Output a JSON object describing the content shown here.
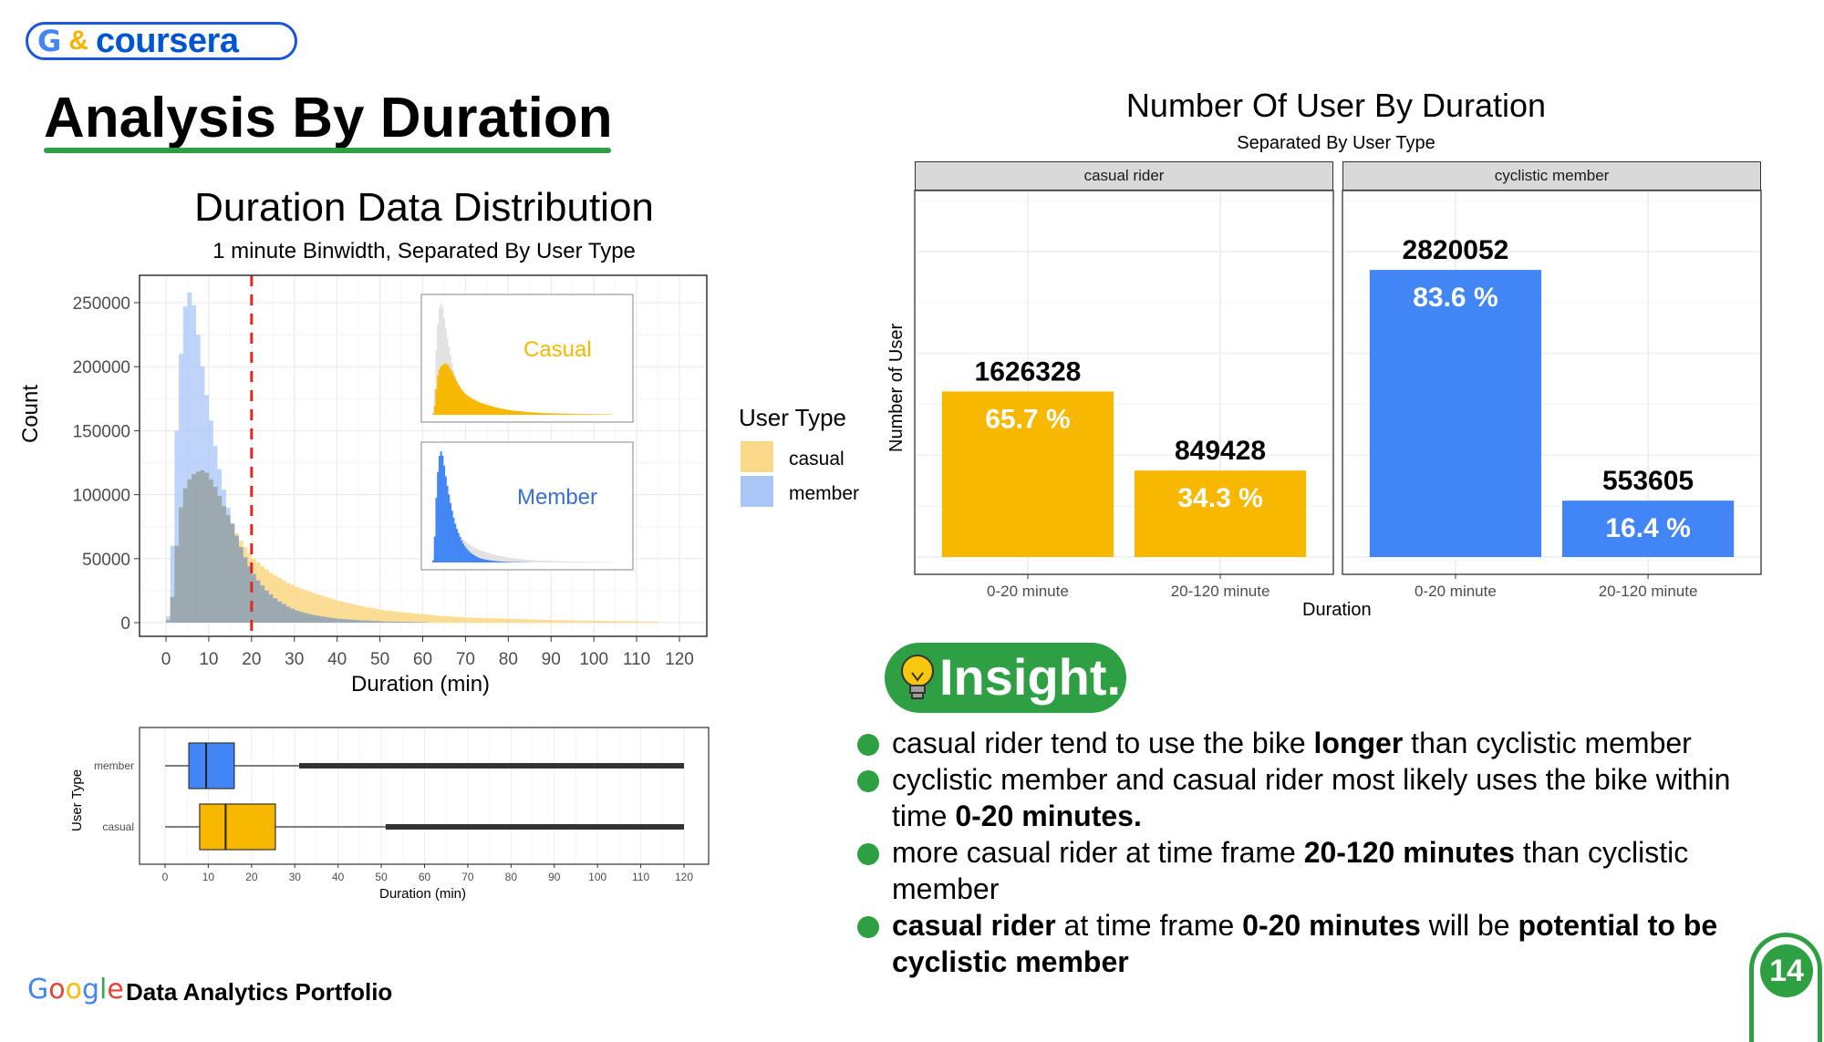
{
  "brand": {
    "g": "G",
    "amp": "&",
    "name": "coursera"
  },
  "page_title": "Analysis By Duration",
  "colors": {
    "casual": "#f9b800",
    "member": "#4285f4",
    "casual_fill_light": "#fbd98a",
    "member_fill_light": "#a9c6f7",
    "green": "#2ea043",
    "cutoff": "#e0281f"
  },
  "histogram": {
    "title": "Duration Data Distribution",
    "subtitle": "1 minute Binwidth, Separated By User Type",
    "inset_labels": {
      "casual": "Casual",
      "member": "Member"
    }
  },
  "legend": {
    "title": "User Type",
    "items": [
      "casual",
      "member"
    ]
  },
  "boxplot": {},
  "bar_chart": {
    "title": "Number Of User By Duration",
    "subtitle": "Separated By User Type"
  },
  "chart_data": [
    {
      "type": "bar",
      "subtype": "histogram",
      "title": "Duration Data Distribution",
      "subtitle": "1 minute Binwidth, Separated By User Type",
      "xlabel": "Duration (min)",
      "ylabel": "Count",
      "xlim": [
        0,
        120
      ],
      "ylim": [
        0,
        260000
      ],
      "x_ticks": [
        0,
        10,
        20,
        30,
        40,
        50,
        60,
        70,
        80,
        90,
        100,
        110,
        120
      ],
      "y_ticks": [
        0,
        50000,
        100000,
        150000,
        200000,
        250000
      ],
      "y_tick_labels": [
        "0",
        "50000",
        "100000",
        "150000",
        "200000",
        "250000"
      ],
      "reference_line": {
        "x": 20,
        "style": "dashed"
      },
      "grid": true,
      "series": [
        {
          "name": "member",
          "color": "#a9c6f7",
          "x": [
            0,
            1,
            2,
            3,
            4,
            5,
            6,
            7,
            8,
            9,
            10,
            11,
            12,
            13,
            14,
            15,
            16,
            17,
            18,
            19,
            20,
            21,
            22,
            23,
            24,
            25,
            26,
            27,
            28,
            29,
            30,
            32,
            34,
            36,
            38,
            40,
            45,
            50,
            55,
            60
          ],
          "values": [
            5000,
            60000,
            150000,
            210000,
            247000,
            258000,
            248000,
            225000,
            200000,
            178000,
            158000,
            138000,
            120000,
            104000,
            90000,
            78000,
            68000,
            59000,
            51000,
            44000,
            38000,
            33000,
            29000,
            25000,
            22000,
            19000,
            16500,
            14500,
            12500,
            11000,
            9500,
            7500,
            6000,
            4800,
            3800,
            3000,
            1800,
            1000,
            600,
            300
          ]
        },
        {
          "name": "casual",
          "color": "#fbd98a",
          "x": [
            0,
            1,
            2,
            3,
            4,
            5,
            6,
            7,
            8,
            9,
            10,
            11,
            12,
            13,
            14,
            15,
            16,
            17,
            18,
            19,
            20,
            22,
            24,
            26,
            28,
            30,
            35,
            40,
            45,
            50,
            55,
            60,
            65,
            70,
            80,
            90,
            100,
            110,
            114
          ],
          "values": [
            2000,
            20000,
            60000,
            90000,
            105000,
            112000,
            116000,
            118000,
            119000,
            117000,
            112000,
            106000,
            99000,
            91000,
            84000,
            77000,
            70000,
            64000,
            59000,
            54000,
            50000,
            44000,
            39000,
            35000,
            31000,
            28000,
            22000,
            17000,
            13000,
            10000,
            8000,
            6500,
            5000,
            4000,
            3000,
            2000,
            1500,
            1000,
            800
          ]
        }
      ],
      "insets": [
        {
          "label": "Casual",
          "series": "casual"
        },
        {
          "label": "Member",
          "series": "member"
        }
      ]
    },
    {
      "type": "boxplot",
      "xlabel": "Duration (min)",
      "ylabel": "User Type",
      "xlim": [
        0,
        120
      ],
      "x_ticks": [
        0,
        10,
        20,
        30,
        40,
        50,
        60,
        70,
        80,
        90,
        100,
        110,
        120
      ],
      "categories": [
        "member",
        "casual"
      ],
      "series": [
        {
          "name": "member",
          "color": "#4285f4",
          "whisker_low": 0,
          "q1": 5.5,
          "median": 9.5,
          "q3": 16,
          "whisker_high": 31,
          "outliers_to": 120
        },
        {
          "name": "casual",
          "color": "#f9b800",
          "whisker_low": 0,
          "q1": 8,
          "median": 14,
          "q3": 25.5,
          "whisker_high": 51,
          "outliers_to": 120
        }
      ]
    },
    {
      "type": "bar",
      "title": "Number Of User By Duration",
      "subtitle": "Separated By User Type",
      "xlabel": "Duration",
      "ylabel": "Number of User",
      "categories": [
        "0-20 minute",
        "20-120 minute"
      ],
      "ylim": [
        0,
        3600000
      ],
      "facets": [
        {
          "name": "casual rider",
          "color": "#f9b800",
          "values": [
            1626328,
            849428
          ],
          "value_labels": [
            "1626328",
            "849428"
          ],
          "percent_labels": [
            "65.7 %",
            "34.3 %"
          ]
        },
        {
          "name": "cyclistic member",
          "color": "#4285f4",
          "values": [
            2820052,
            553605
          ],
          "value_labels": [
            "2820052",
            "553605"
          ],
          "percent_labels": [
            "83.6 %",
            "16.4 %"
          ]
        }
      ]
    }
  ],
  "insight": {
    "label": "Insight.",
    "items": [
      [
        {
          "t": "casual rider tend to use the bike "
        },
        {
          "t": "longer",
          "b": true
        },
        {
          "t": " than cyclistic member"
        }
      ],
      [
        {
          "t": "cyclistic member and casual rider most likely uses the bike within time "
        },
        {
          "t": "0-20 minutes.",
          "b": true
        }
      ],
      [
        {
          "t": "more casual rider at time frame "
        },
        {
          "t": "20-120 minutes",
          "b": true
        },
        {
          "t": " than cyclistic member"
        }
      ],
      [
        {
          "t": "casual rider",
          "b": true
        },
        {
          "t": " at time frame "
        },
        {
          "t": "0-20 minutes",
          "b": true
        },
        {
          "t": " will be "
        },
        {
          "t": "potential to be cyclistic member",
          "b": true
        }
      ]
    ]
  },
  "footer": {
    "google": "Google",
    "text": "Data Analytics Portfolio",
    "page_number": "14"
  }
}
